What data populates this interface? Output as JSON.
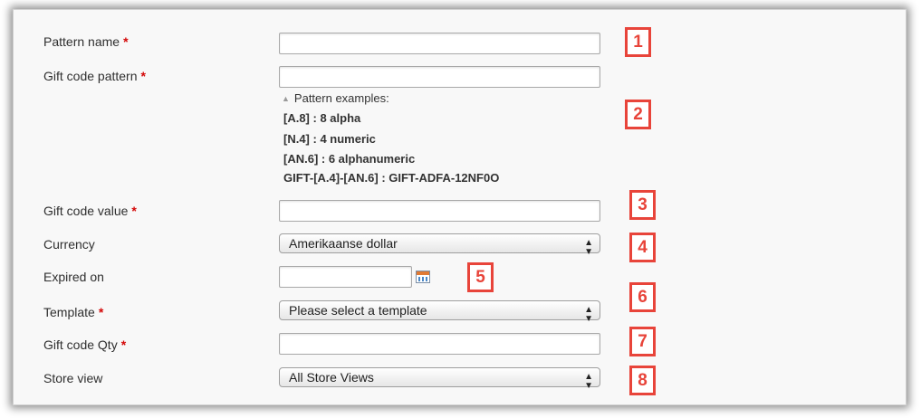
{
  "form": {
    "fields": {
      "pattern_name": {
        "label": "Pattern name",
        "required": "*",
        "value": ""
      },
      "gift_code_pattern": {
        "label": "Gift code pattern",
        "required": "*",
        "value": ""
      },
      "gift_code_value": {
        "label": "Gift code value",
        "required": "*",
        "value": ""
      },
      "currency": {
        "label": "Currency",
        "selected": "Amerikaanse dollar"
      },
      "expired_on": {
        "label": "Expired on",
        "value": ""
      },
      "template": {
        "label": "Template",
        "required": "*",
        "selected": "Please select a template"
      },
      "gift_code_qty": {
        "label": "Gift code Qty",
        "required": "*",
        "value": ""
      },
      "store_view": {
        "label": "Store view",
        "selected": "All Store Views"
      }
    },
    "pattern_hint": {
      "title": "Pattern examples:",
      "examples": [
        "[A.8] : 8 alpha",
        "[N.4] : 4 numeric",
        "[AN.6] : 6 alphanumeric",
        "GIFT-[A.4]-[AN.6] : GIFT-ADFA-12NF0O"
      ]
    }
  },
  "badges": [
    "1",
    "2",
    "3",
    "4",
    "5",
    "6",
    "7",
    "8"
  ],
  "icons": {
    "hint_toggle": "triangle-up-icon",
    "date_picker": "calendar-icon",
    "select_arrows": "updown-arrows-icon"
  },
  "colors": {
    "badge": "#e8443a",
    "required": "#d40707",
    "panel": "#f8f8f8"
  }
}
